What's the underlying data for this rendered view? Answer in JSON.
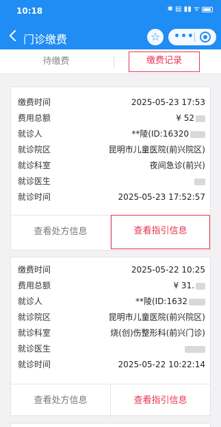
{
  "status_bar": {
    "time": "10:18",
    "indicators": "✱ ▤ ▮▮ ᯤ"
  },
  "header": {
    "title": "门诊缴费",
    "back_icon": "chevron-left-icon",
    "star_icon": "☆",
    "more_icon": "•••"
  },
  "tabs": {
    "pending": "待缴费",
    "records": "缴费记录"
  },
  "records": [
    {
      "rows": [
        {
          "label": "缴费时间",
          "value": "2025-05-23 17:53"
        },
        {
          "label": "费用总额",
          "value": "¥ 52"
        },
        {
          "label": "就诊人",
          "value": "**陵(ID:16320"
        },
        {
          "label": "就诊院区",
          "value": "昆明市儿童医院(前兴院区)"
        },
        {
          "label": "就诊科室",
          "value": "夜间急诊(前兴)"
        },
        {
          "label": "就诊医生",
          "value": ""
        },
        {
          "label": "就诊时间",
          "value": "2025-05-23 17:52:57"
        }
      ],
      "action_left": "查看处方信息",
      "action_right": "查看指引信息"
    },
    {
      "rows": [
        {
          "label": "缴费时间",
          "value": "2025-05-22 10:25"
        },
        {
          "label": "费用总额",
          "value": "¥ 31."
        },
        {
          "label": "就诊人",
          "value": "**陵(ID:1632"
        },
        {
          "label": "就诊院区",
          "value": "昆明市儿童医院(前兴院区)"
        },
        {
          "label": "就诊科室",
          "value": "烧(创)伤整形科(前兴门诊)"
        },
        {
          "label": "就诊医生",
          "value": ""
        },
        {
          "label": "就诊时间",
          "value": "2025-05-22 10:22:14"
        }
      ],
      "action_left": "查看处方信息",
      "action_right": "查看指引信息"
    }
  ],
  "colors": {
    "primary": "#1f8df3",
    "accent": "#e8344e"
  }
}
